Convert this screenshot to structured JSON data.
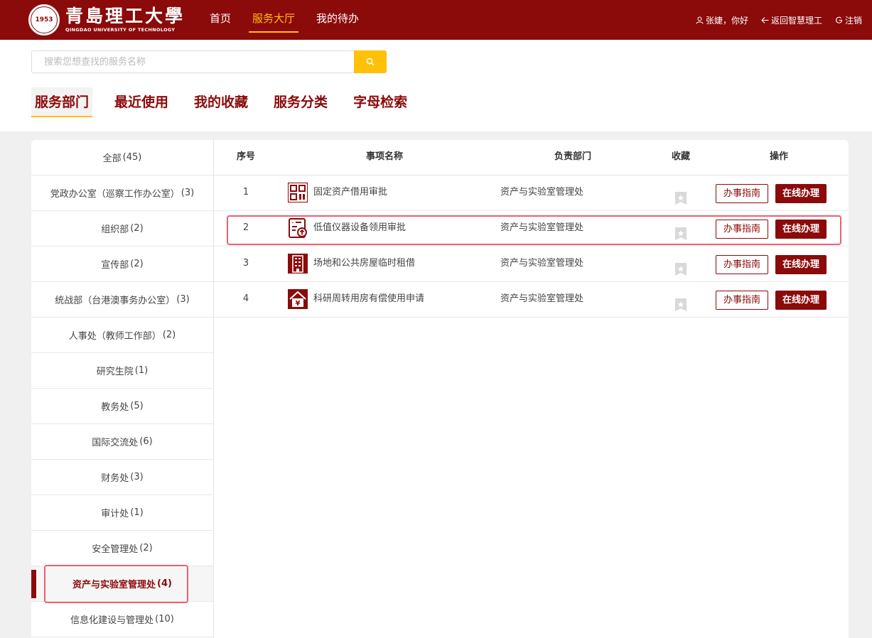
{
  "header": {
    "logo_cn": "青島理工大學",
    "logo_en": "QINGDAO UNIVERSITY OF TECHNOLOGY",
    "seal_text": "青岛理工大学",
    "nav": [
      {
        "label": "首页",
        "active": false
      },
      {
        "label": "服务大厅",
        "active": true
      },
      {
        "label": "我的待办",
        "active": false
      }
    ],
    "user_greeting": "张婕，你好",
    "back_link": "返回智慧理工",
    "logout": "注销"
  },
  "search": {
    "placeholder": "搜索您想查找的服务名称",
    "value": ""
  },
  "tabs": [
    {
      "label": "服务部门",
      "active": true
    },
    {
      "label": "最近使用",
      "active": false
    },
    {
      "label": "我的收藏",
      "active": false
    },
    {
      "label": "服务分类",
      "active": false
    },
    {
      "label": "字母检索",
      "active": false
    }
  ],
  "departments": [
    {
      "name": "全部",
      "count": "(45)"
    },
    {
      "name": "党政办公室（巡察工作办公室）",
      "count": "(3)"
    },
    {
      "name": "组织部",
      "count": "(2)"
    },
    {
      "name": "宣传部",
      "count": "(2)"
    },
    {
      "name": "统战部（台港澳事务办公室）",
      "count": "(3)"
    },
    {
      "name": "人事处（教师工作部）",
      "count": "(2)"
    },
    {
      "name": "研究生院",
      "count": "(1)"
    },
    {
      "name": "教务处",
      "count": "(5)"
    },
    {
      "name": "国际交流处",
      "count": "(6)"
    },
    {
      "name": "财务处",
      "count": "(3)"
    },
    {
      "name": "审计处",
      "count": "(1)"
    },
    {
      "name": "安全管理处",
      "count": "(2)"
    },
    {
      "name": "资产与实验室管理处",
      "count": "(4)",
      "selected": true
    },
    {
      "name": "信息化建设与管理处",
      "count": "(10)"
    }
  ],
  "table": {
    "headers": {
      "no": "序号",
      "name": "事项名称",
      "dept": "负责部门",
      "fav": "收藏",
      "ops": "操作"
    },
    "rows": [
      {
        "no": "1",
        "icon": "qr-grid-icon",
        "name": "固定资产借用审批",
        "dept": "资产与实验室管理处",
        "guide": "办事指南",
        "online": "在线办理"
      },
      {
        "no": "2",
        "icon": "form-upload-icon",
        "name": "低值仪器设备领用审批",
        "dept": "资产与实验室管理处",
        "guide": "办事指南",
        "online": "在线办理"
      },
      {
        "no": "3",
        "icon": "building-icon",
        "name": "场地和公共房屋临时租借",
        "dept": "资产与实验室管理处",
        "guide": "办事指南",
        "online": "在线办理"
      },
      {
        "no": "4",
        "icon": "house-yen-icon",
        "name": "科研周转用房有偿使用申请",
        "dept": "资产与实验室管理处",
        "guide": "办事指南",
        "online": "在线办理"
      }
    ]
  },
  "colors": {
    "brand": "#8b0a0a",
    "accent": "#ffc107",
    "highlight": "#ef5f6b"
  }
}
